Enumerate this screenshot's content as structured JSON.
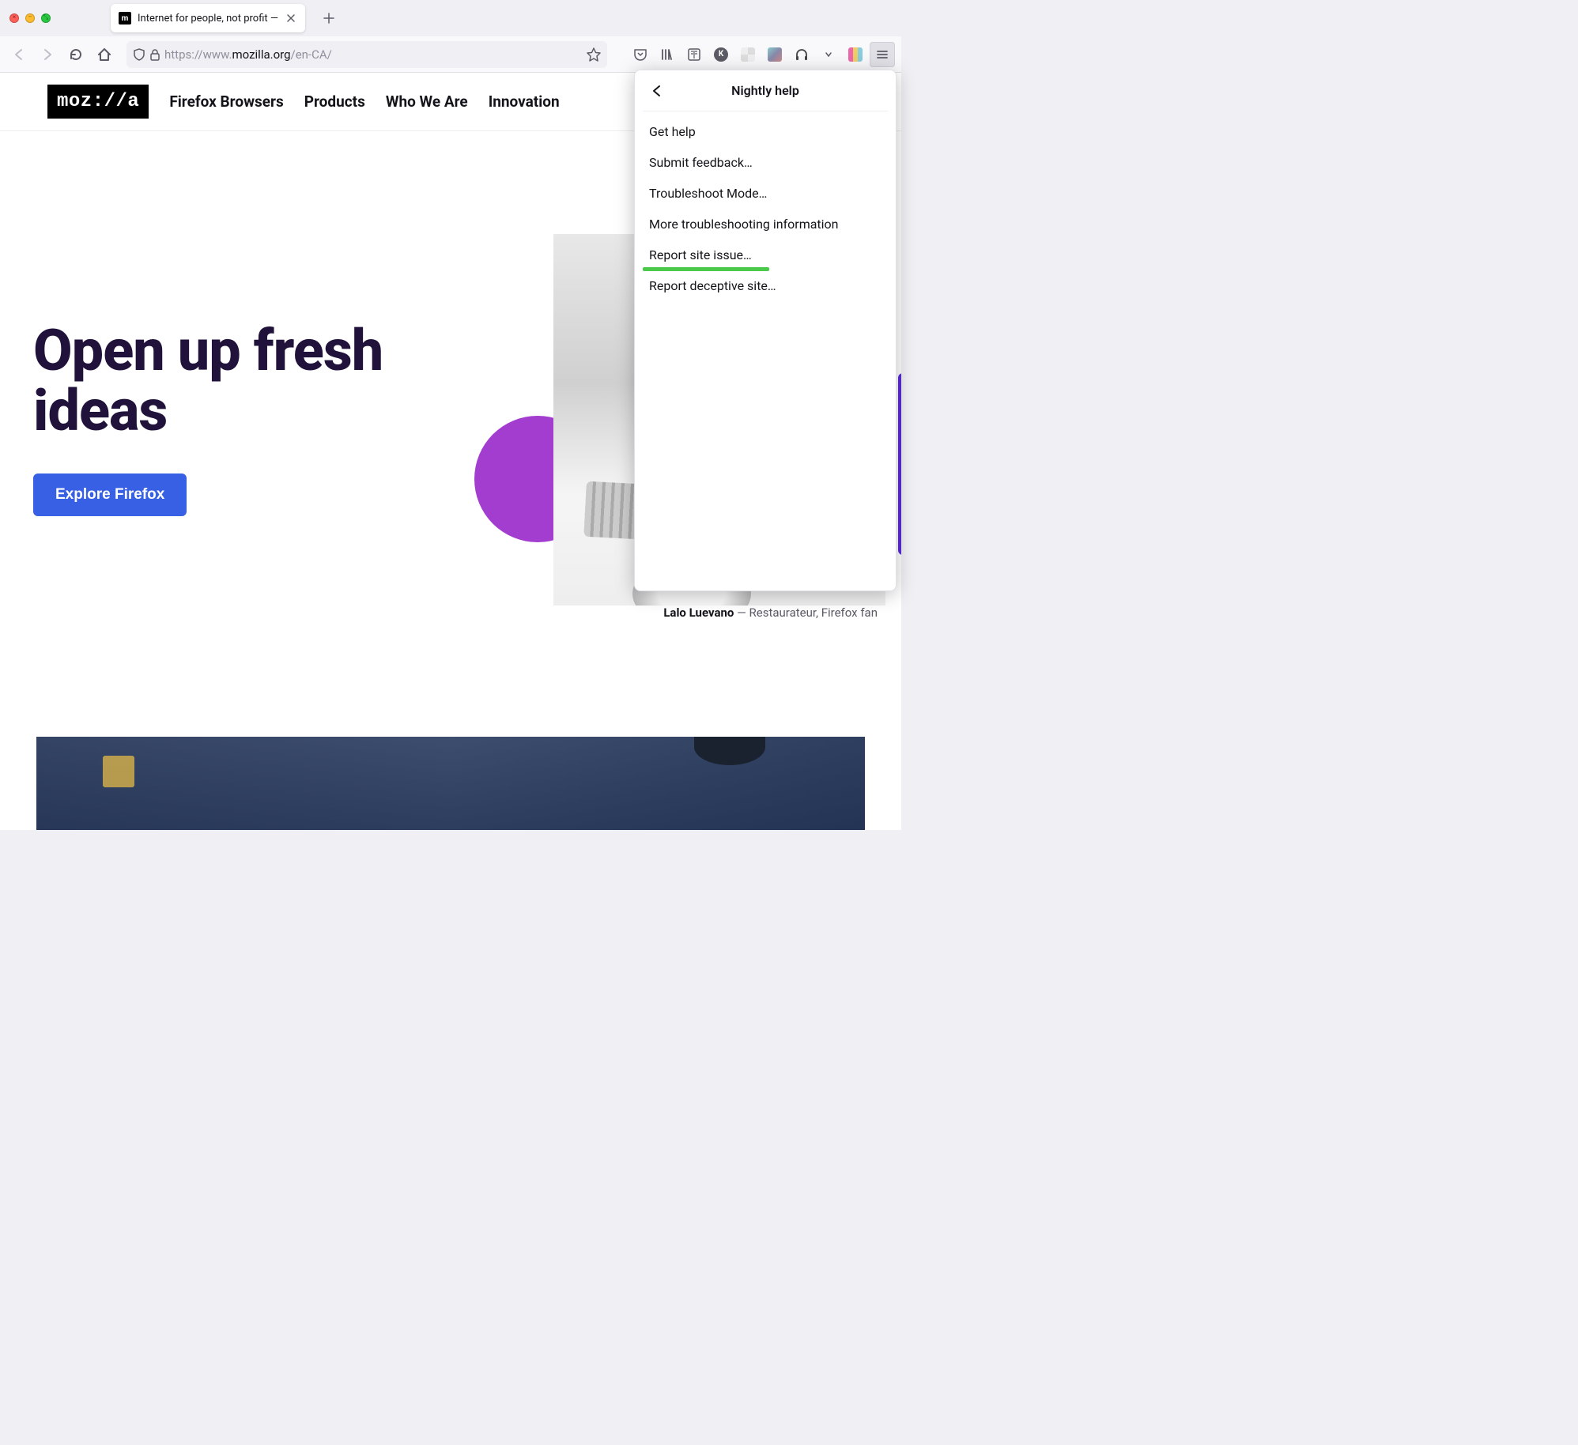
{
  "window": {
    "tab_title": "Internet for people, not profit —",
    "url_proto": "https://www.",
    "url_domain": "mozilla.org",
    "url_path": "/en-CA/"
  },
  "site_nav": {
    "logo_text": "moz://a",
    "items": [
      "Firefox Browsers",
      "Products",
      "Who We Are",
      "Innovation"
    ]
  },
  "hero": {
    "title_line1": "Open up fresh",
    "title_line2": "ideas",
    "cta_label": "Explore Firefox",
    "caption_name": "Lalo Luevano",
    "caption_sep": " — ",
    "caption_role": "Restaurateur, Firefox fan"
  },
  "help_panel": {
    "title": "Nightly help",
    "items": [
      "Get help",
      "Submit feedback…",
      "Troubleshoot Mode…",
      "More troubleshooting information",
      "Report site issue…",
      "Report deceptive site…"
    ]
  }
}
